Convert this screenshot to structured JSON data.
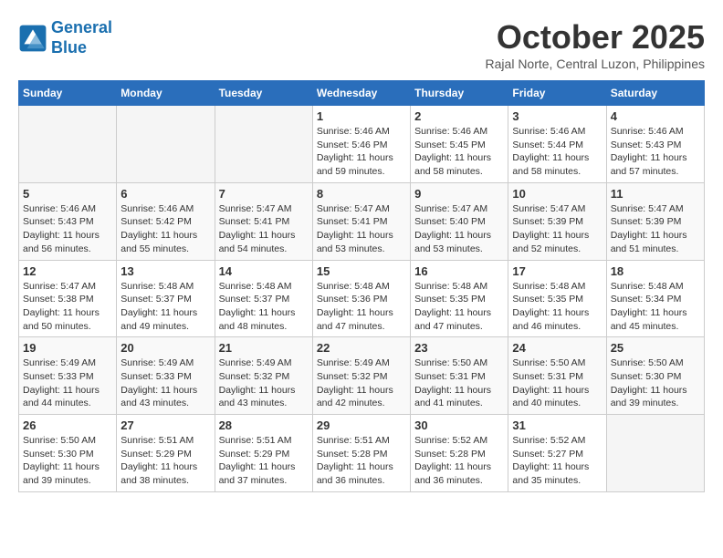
{
  "header": {
    "logo_line1": "General",
    "logo_line2": "Blue",
    "month_title": "October 2025",
    "location": "Rajal Norte, Central Luzon, Philippines"
  },
  "weekdays": [
    "Sunday",
    "Monday",
    "Tuesday",
    "Wednesday",
    "Thursday",
    "Friday",
    "Saturday"
  ],
  "weeks": [
    [
      {
        "day": "",
        "info": ""
      },
      {
        "day": "",
        "info": ""
      },
      {
        "day": "",
        "info": ""
      },
      {
        "day": "1",
        "info": "Sunrise: 5:46 AM\nSunset: 5:46 PM\nDaylight: 11 hours\nand 59 minutes."
      },
      {
        "day": "2",
        "info": "Sunrise: 5:46 AM\nSunset: 5:45 PM\nDaylight: 11 hours\nand 58 minutes."
      },
      {
        "day": "3",
        "info": "Sunrise: 5:46 AM\nSunset: 5:44 PM\nDaylight: 11 hours\nand 58 minutes."
      },
      {
        "day": "4",
        "info": "Sunrise: 5:46 AM\nSunset: 5:43 PM\nDaylight: 11 hours\nand 57 minutes."
      }
    ],
    [
      {
        "day": "5",
        "info": "Sunrise: 5:46 AM\nSunset: 5:43 PM\nDaylight: 11 hours\nand 56 minutes."
      },
      {
        "day": "6",
        "info": "Sunrise: 5:46 AM\nSunset: 5:42 PM\nDaylight: 11 hours\nand 55 minutes."
      },
      {
        "day": "7",
        "info": "Sunrise: 5:47 AM\nSunset: 5:41 PM\nDaylight: 11 hours\nand 54 minutes."
      },
      {
        "day": "8",
        "info": "Sunrise: 5:47 AM\nSunset: 5:41 PM\nDaylight: 11 hours\nand 53 minutes."
      },
      {
        "day": "9",
        "info": "Sunrise: 5:47 AM\nSunset: 5:40 PM\nDaylight: 11 hours\nand 53 minutes."
      },
      {
        "day": "10",
        "info": "Sunrise: 5:47 AM\nSunset: 5:39 PM\nDaylight: 11 hours\nand 52 minutes."
      },
      {
        "day": "11",
        "info": "Sunrise: 5:47 AM\nSunset: 5:39 PM\nDaylight: 11 hours\nand 51 minutes."
      }
    ],
    [
      {
        "day": "12",
        "info": "Sunrise: 5:47 AM\nSunset: 5:38 PM\nDaylight: 11 hours\nand 50 minutes."
      },
      {
        "day": "13",
        "info": "Sunrise: 5:48 AM\nSunset: 5:37 PM\nDaylight: 11 hours\nand 49 minutes."
      },
      {
        "day": "14",
        "info": "Sunrise: 5:48 AM\nSunset: 5:37 PM\nDaylight: 11 hours\nand 48 minutes."
      },
      {
        "day": "15",
        "info": "Sunrise: 5:48 AM\nSunset: 5:36 PM\nDaylight: 11 hours\nand 47 minutes."
      },
      {
        "day": "16",
        "info": "Sunrise: 5:48 AM\nSunset: 5:35 PM\nDaylight: 11 hours\nand 47 minutes."
      },
      {
        "day": "17",
        "info": "Sunrise: 5:48 AM\nSunset: 5:35 PM\nDaylight: 11 hours\nand 46 minutes."
      },
      {
        "day": "18",
        "info": "Sunrise: 5:48 AM\nSunset: 5:34 PM\nDaylight: 11 hours\nand 45 minutes."
      }
    ],
    [
      {
        "day": "19",
        "info": "Sunrise: 5:49 AM\nSunset: 5:33 PM\nDaylight: 11 hours\nand 44 minutes."
      },
      {
        "day": "20",
        "info": "Sunrise: 5:49 AM\nSunset: 5:33 PM\nDaylight: 11 hours\nand 43 minutes."
      },
      {
        "day": "21",
        "info": "Sunrise: 5:49 AM\nSunset: 5:32 PM\nDaylight: 11 hours\nand 43 minutes."
      },
      {
        "day": "22",
        "info": "Sunrise: 5:49 AM\nSunset: 5:32 PM\nDaylight: 11 hours\nand 42 minutes."
      },
      {
        "day": "23",
        "info": "Sunrise: 5:50 AM\nSunset: 5:31 PM\nDaylight: 11 hours\nand 41 minutes."
      },
      {
        "day": "24",
        "info": "Sunrise: 5:50 AM\nSunset: 5:31 PM\nDaylight: 11 hours\nand 40 minutes."
      },
      {
        "day": "25",
        "info": "Sunrise: 5:50 AM\nSunset: 5:30 PM\nDaylight: 11 hours\nand 39 minutes."
      }
    ],
    [
      {
        "day": "26",
        "info": "Sunrise: 5:50 AM\nSunset: 5:30 PM\nDaylight: 11 hours\nand 39 minutes."
      },
      {
        "day": "27",
        "info": "Sunrise: 5:51 AM\nSunset: 5:29 PM\nDaylight: 11 hours\nand 38 minutes."
      },
      {
        "day": "28",
        "info": "Sunrise: 5:51 AM\nSunset: 5:29 PM\nDaylight: 11 hours\nand 37 minutes."
      },
      {
        "day": "29",
        "info": "Sunrise: 5:51 AM\nSunset: 5:28 PM\nDaylight: 11 hours\nand 36 minutes."
      },
      {
        "day": "30",
        "info": "Sunrise: 5:52 AM\nSunset: 5:28 PM\nDaylight: 11 hours\nand 36 minutes."
      },
      {
        "day": "31",
        "info": "Sunrise: 5:52 AM\nSunset: 5:27 PM\nDaylight: 11 hours\nand 35 minutes."
      },
      {
        "day": "",
        "info": ""
      }
    ]
  ]
}
